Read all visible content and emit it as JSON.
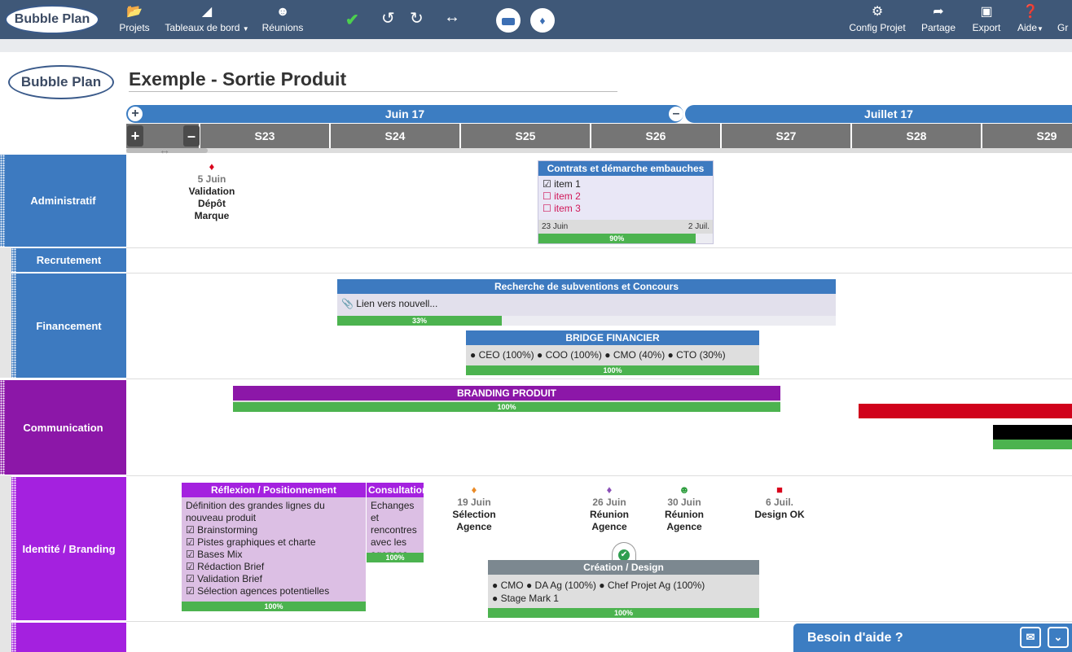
{
  "topbar": {
    "logo": "Bubble Plan",
    "nav": [
      {
        "label": "Projets",
        "icon": "folder-icon"
      },
      {
        "label": "Tableaux de bord",
        "icon": "chart-icon"
      },
      {
        "label": "Réunions",
        "icon": "people-icon"
      }
    ],
    "right": [
      {
        "label": "Config Projet",
        "icon": "gear-icon"
      },
      {
        "label": "Partage",
        "icon": "share-icon"
      },
      {
        "label": "Export",
        "icon": "image-icon"
      },
      {
        "label": "Aide",
        "icon": "help-icon"
      },
      {
        "label": "Gr"
      }
    ]
  },
  "project": {
    "logo": "Bubble Plan",
    "title": "Exemple - Sortie Produit"
  },
  "timeline": {
    "months": [
      "Juin 17",
      "Juillet 17"
    ],
    "weeks": [
      "S23",
      "S24",
      "S25",
      "S26",
      "S27",
      "S28",
      "S29"
    ]
  },
  "lanes": [
    {
      "label": "Administratif",
      "color": "#3d7ac0"
    },
    {
      "label": "Recrutement",
      "color": "#3d7ac0"
    },
    {
      "label": "Financement",
      "color": "#3d7ac0"
    },
    {
      "label": "Communication",
      "color": "#8c17a8"
    },
    {
      "label": "Identité / Branding",
      "color": "#a421df"
    }
  ],
  "milestones": {
    "depot": {
      "date": "5 Juin",
      "lines": [
        "Validation",
        "Dépôt",
        "Marque"
      ],
      "color": "#d9001b"
    },
    "selection": {
      "date": "19 Juin",
      "lines": [
        "Sélection",
        "Agence"
      ],
      "color": "#ea8a26"
    },
    "reunion1": {
      "date": "26 Juin",
      "lines": [
        "Réunion",
        "Agence"
      ],
      "color": "#8a4fb7"
    },
    "reunion2": {
      "date": "30 Juin",
      "lines": [
        "Réunion",
        "Agence"
      ],
      "color": "#2f9e3f"
    },
    "design": {
      "date": "6 Juil.",
      "lines": [
        "Design OK"
      ],
      "color": "#d9001b"
    }
  },
  "tasks": {
    "contrats": {
      "title": "Contrats et démarche embauches",
      "items": [
        {
          "label": "item 1",
          "checked": true
        },
        {
          "label": "item 2",
          "checked": false
        },
        {
          "label": "item 3",
          "checked": false
        }
      ],
      "start": "23 Juin",
      "end": "2 Juil.",
      "progress": "90%",
      "progress_value": 0.9
    },
    "subventions": {
      "title": "Recherche de subventions et Concours",
      "link": "Lien vers nouvell...",
      "progress": "33%",
      "progress_value": 0.33
    },
    "bridge": {
      "title": "BRIDGE FINANCIER",
      "people": [
        "CEO (100%)",
        "COO (100%)",
        "CMO (40%)",
        "CTO (30%)"
      ],
      "progress": "100%",
      "progress_value": 1
    },
    "branding": {
      "title": "BRANDING PRODUIT",
      "progress": "100%",
      "progress_value": 1
    },
    "reflexion": {
      "title": "Réflexion / Positionnement",
      "desc": "Définition des grandes lignes du nouveau produit",
      "checks": [
        "Brainstorming",
        "Pistes graphiques et charte",
        "Bases Mix",
        "Rédaction Brief",
        "Validation Brief",
        "Sélection agences potentielles"
      ],
      "progress": "100%",
      "progress_value": 1
    },
    "consultation": {
      "title": "Consultation",
      "desc": "Echanges et rencontres avec les agences",
      "progress": "100%",
      "progress_value": 1
    },
    "creation": {
      "title": "Création / Design",
      "people": [
        "CMO",
        "DA Ag (100%)",
        "Chef Projet Ag (100%)",
        "Stage Mark 1"
      ],
      "progress": "100%",
      "progress_value": 1
    }
  },
  "help": {
    "label": "Besoin d'aide ?"
  }
}
